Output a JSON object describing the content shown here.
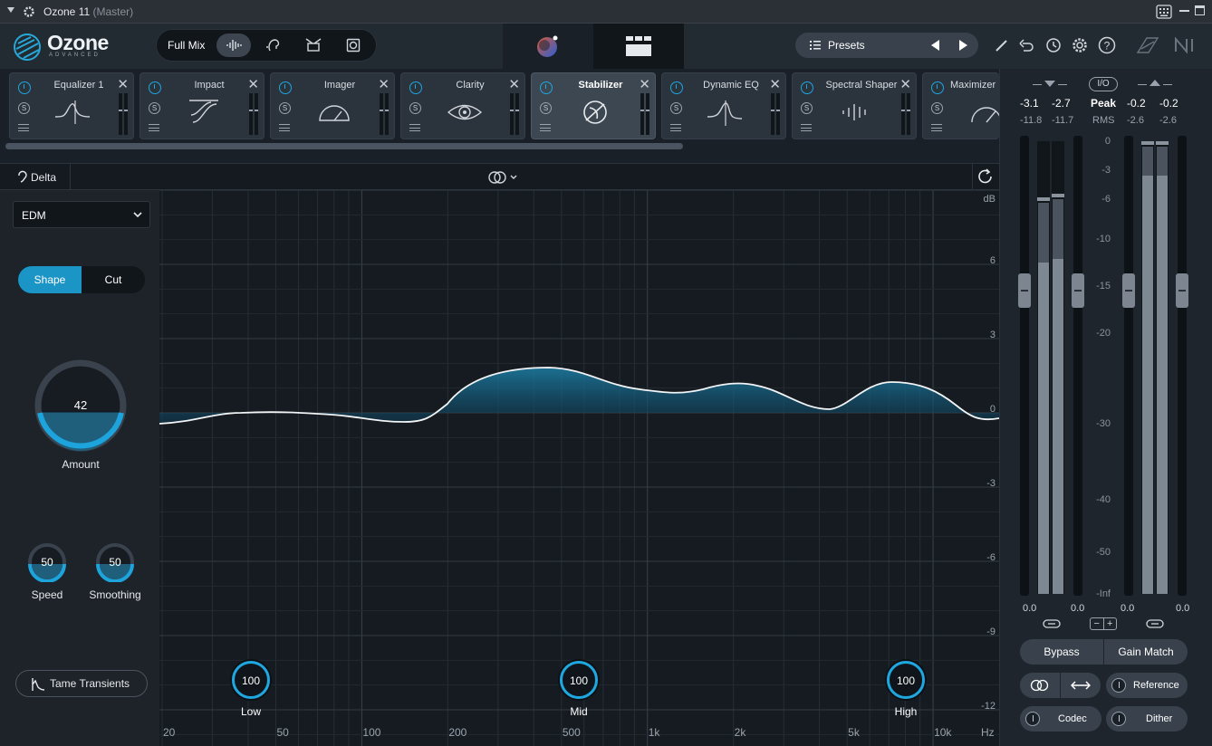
{
  "titlebar": {
    "app": "Ozone 11",
    "mode": "(Master)"
  },
  "brand": {
    "name": "Ozone",
    "edition": "ADVANCED"
  },
  "header": {
    "full_mix": "Full Mix",
    "presets": "Presets"
  },
  "modules": [
    {
      "name": "Equalizer 1",
      "active": false
    },
    {
      "name": "Impact",
      "active": false
    },
    {
      "name": "Imager",
      "active": false
    },
    {
      "name": "Clarity",
      "active": false
    },
    {
      "name": "Stabilizer",
      "active": true
    },
    {
      "name": "Dynamic EQ",
      "active": false
    },
    {
      "name": "Spectral Shaper",
      "active": false
    },
    {
      "name": "Maximizer",
      "active": false
    }
  ],
  "toolbar": {
    "delta": "Delta"
  },
  "left": {
    "preset": "EDM",
    "shape": "Shape",
    "cut": "Cut",
    "amount": {
      "label": "Amount",
      "value": "42"
    },
    "speed": {
      "label": "Speed",
      "value": "50"
    },
    "smoothing": {
      "label": "Smoothing",
      "value": "50"
    },
    "tame": "Tame Transients"
  },
  "graph": {
    "db_unit": "dB",
    "db_ticks": [
      "6",
      "3",
      "0",
      "-3",
      "-6",
      "-9",
      "-12"
    ],
    "hz_unit": "Hz",
    "hz_ticks": [
      "20",
      "50",
      "100",
      "200",
      "500",
      "1k",
      "2k",
      "5k",
      "10k"
    ],
    "bands": [
      {
        "name": "Low",
        "value": "100"
      },
      {
        "name": "Mid",
        "value": "100"
      },
      {
        "name": "High",
        "value": "100"
      }
    ]
  },
  "meter": {
    "in_peak_l": "-3.1",
    "in_peak_r": "-2.7",
    "in_rms_l": "-11.8",
    "in_rms_r": "-11.7",
    "io": "I/O",
    "peak": "Peak",
    "rms": "RMS",
    "out_peak_l": "-0.2",
    "out_peak_r": "-0.2",
    "out_rms_l": "-2.6",
    "out_rms_r": "-2.6",
    "scale": [
      "0",
      "-3",
      "-6",
      "-10",
      "-15",
      "-20",
      "-30",
      "-40",
      "-50",
      "-Inf"
    ],
    "in_gain_l": "0.0",
    "in_gain_r": "0.0",
    "out_gain_l": "0.0",
    "out_gain_r": "0.0",
    "bypass": "Bypass",
    "gain_match": "Gain Match",
    "reference": "Reference",
    "codec": "Codec",
    "dither": "Dither"
  },
  "colors": {
    "accent": "#1fa7e0",
    "bg": "#1d232b"
  }
}
